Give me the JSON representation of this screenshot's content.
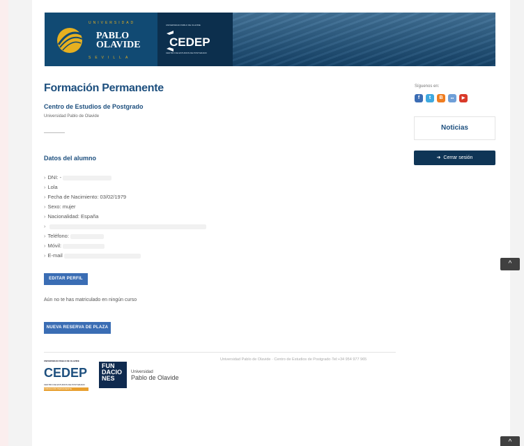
{
  "banner": {
    "university_top": "UNIVERSIDAD",
    "university_name_1": "PABLO",
    "university_name_2": "OLAVIDE",
    "university_city": "SEVILLA",
    "cedep_top": "UNIVERSIDAD PABLO DE OLAVIDE",
    "cedep_name": "CEDEP",
    "cedep_sub": "CENTRO DE ESTUDIOS DE POSTGRADO"
  },
  "page": {
    "title": "Formación Permanente",
    "subtitle": "Centro de Estudios de Postgrado",
    "university": "Universidad Pablo de Olavide"
  },
  "student": {
    "section_title": "Datos del alumno",
    "fields": [
      {
        "label": "DNI: -",
        "redacted": true
      },
      {
        "label": "Lola",
        "redacted": false
      },
      {
        "label": "Fecha de Nacimiento: 03/02/1979",
        "redacted": false
      },
      {
        "label": "Sexo: mujer",
        "redacted": false
      },
      {
        "label": "Nacionalidad: España",
        "redacted": false
      },
      {
        "label": "",
        "redacted": true
      },
      {
        "label": "Teléfono:",
        "redacted": true
      },
      {
        "label": "Móvil:",
        "redacted": true
      },
      {
        "label": "E-mail",
        "redacted": true
      }
    ]
  },
  "actions": {
    "edit_profile": "EDITAR PERFIL",
    "not_enrolled": "Aún no te has matriculado en ningún curso",
    "new_reservation": "NUEVA RESERVA DE PLAZA"
  },
  "sidebar": {
    "follow_label": "Síguenos en:",
    "socials": [
      {
        "icon": "facebook-icon",
        "glyph": "f",
        "color": "#3b6cb4"
      },
      {
        "icon": "twitter-icon",
        "glyph": "t",
        "color": "#3fa9e0"
      },
      {
        "icon": "blogger-icon",
        "glyph": "B",
        "color": "#f07d20"
      },
      {
        "icon": "flickr-icon",
        "glyph": "●●",
        "color": "#6f9fd8"
      },
      {
        "icon": "youtube-icon",
        "glyph": "▶",
        "color": "#d93a2a"
      }
    ],
    "news": "Noticias",
    "logout": "Cerrar sesión"
  },
  "footer": {
    "text": "Universidad Pablo de Olavide · Centro de Estudios de Postgrado·Tel:+34  954 977 965",
    "cedep_cap": "UNIVERSIDAD PABLO DE OLAVIDE",
    "cedep_word": "CEDEP",
    "cedep_small": "CENTRO DE ESTUDIOS DE POSTGRADO",
    "cedep_orange": "FORMACIÓN PERMANENTE",
    "fund_line_1": "FUN",
    "fund_line_2": "DACIO",
    "fund_line_3": "NES",
    "upo_a": "Universidad",
    "upo_b": "Pablo de Olavide"
  },
  "scroll": {
    "up_glyph": "^"
  }
}
